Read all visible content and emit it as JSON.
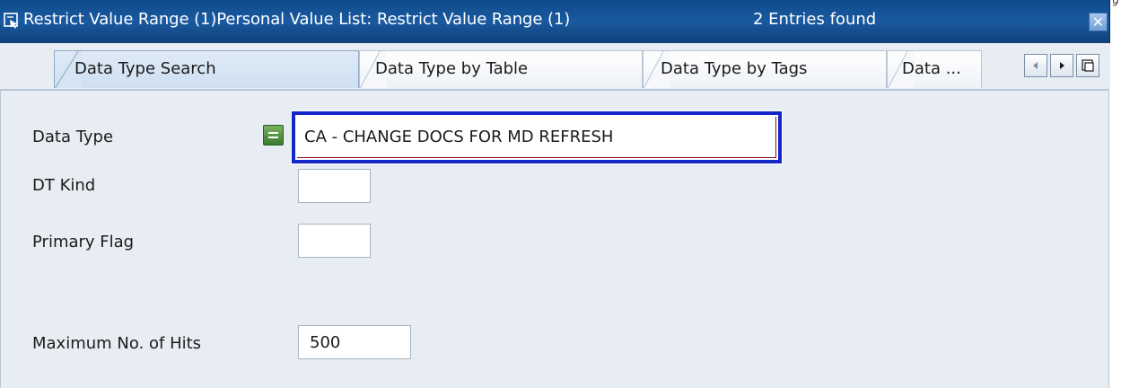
{
  "window": {
    "title": "Restrict Value Range (1)Personal Value List: Restrict Value Range (1)",
    "entries_found": "2 Entries found",
    "close_symbol": "✕",
    "title_bar_color": "#154f93"
  },
  "edge_text": "g",
  "tabs": [
    {
      "label": "Data Type Search",
      "active": true
    },
    {
      "label": "Data Type by Table",
      "active": false
    },
    {
      "label": "Data Type by Tags",
      "active": false
    },
    {
      "label": "Data ...",
      "active": false
    }
  ],
  "tab_scroll": {
    "icons": [
      "scroll-left-icon",
      "scroll-right-icon",
      "tab-list-icon"
    ]
  },
  "form": {
    "data_type": {
      "label": "Data Type",
      "value": "CA - CHANGE DOCS FOR MD REFRESH",
      "operator_icon": "equals-operator-icon"
    },
    "dt_kind": {
      "label": "DT Kind",
      "value": ""
    },
    "primary_flag": {
      "label": "Primary Flag",
      "value": ""
    },
    "max_hits": {
      "label": "Maximum No. of Hits",
      "value": "500"
    }
  },
  "colors": {
    "focus_border": "#1426c8",
    "operator_green": "#4f8a3a",
    "panel_bg": "#e8edf3"
  }
}
